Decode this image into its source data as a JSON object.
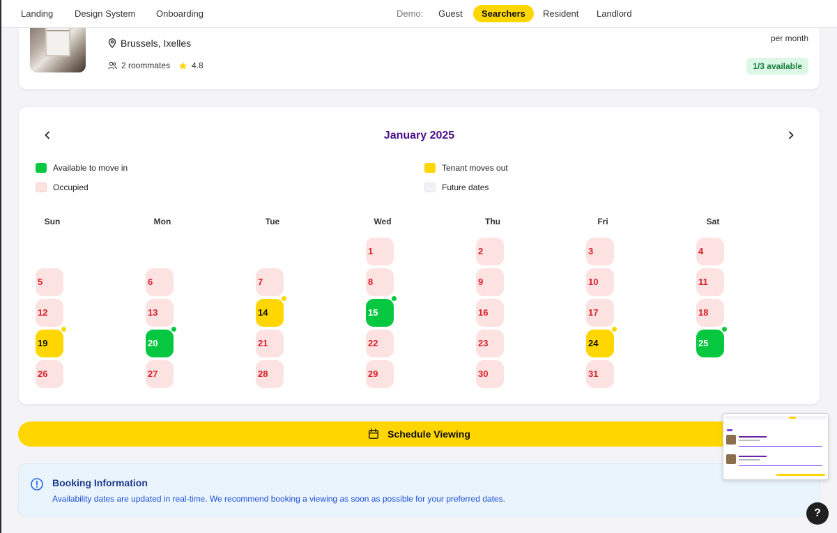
{
  "nav": {
    "links": [
      "Landing",
      "Design System",
      "Onboarding"
    ],
    "demo_label": "Demo:",
    "demo_options": [
      "Guest",
      "Searchers",
      "Resident",
      "Landlord"
    ],
    "active_demo": "Searchers"
  },
  "listing": {
    "location": "Brussels, Ixelles",
    "roommates": "2 roommates",
    "rating": "4.8",
    "price_unit": "per month",
    "availability_badge": "1/3 available"
  },
  "calendar": {
    "month_title": "January 2025",
    "legend": {
      "available": "Available to move in",
      "moveout": "Tenant moves out",
      "occupied": "Occupied",
      "future": "Future dates"
    },
    "weekdays": [
      "Sun",
      "Mon",
      "Tue",
      "Wed",
      "Thu",
      "Fri",
      "Sat"
    ],
    "first_weekday_index": 3,
    "days": [
      {
        "d": "1",
        "s": "occupied"
      },
      {
        "d": "2",
        "s": "occupied"
      },
      {
        "d": "3",
        "s": "occupied"
      },
      {
        "d": "4",
        "s": "occupied"
      },
      {
        "d": "5",
        "s": "occupied"
      },
      {
        "d": "6",
        "s": "occupied"
      },
      {
        "d": "7",
        "s": "occupied"
      },
      {
        "d": "8",
        "s": "occupied"
      },
      {
        "d": "9",
        "s": "occupied"
      },
      {
        "d": "10",
        "s": "occupied"
      },
      {
        "d": "11",
        "s": "occupied"
      },
      {
        "d": "12",
        "s": "occupied"
      },
      {
        "d": "13",
        "s": "occupied"
      },
      {
        "d": "14",
        "s": "moveout"
      },
      {
        "d": "15",
        "s": "available"
      },
      {
        "d": "16",
        "s": "occupied"
      },
      {
        "d": "17",
        "s": "occupied"
      },
      {
        "d": "18",
        "s": "occupied"
      },
      {
        "d": "19",
        "s": "moveout"
      },
      {
        "d": "20",
        "s": "available"
      },
      {
        "d": "21",
        "s": "occupied"
      },
      {
        "d": "22",
        "s": "occupied"
      },
      {
        "d": "23",
        "s": "occupied"
      },
      {
        "d": "24",
        "s": "moveout"
      },
      {
        "d": "25",
        "s": "available"
      },
      {
        "d": "26",
        "s": "occupied"
      },
      {
        "d": "27",
        "s": "occupied"
      },
      {
        "d": "28",
        "s": "occupied"
      },
      {
        "d": "29",
        "s": "occupied"
      },
      {
        "d": "30",
        "s": "occupied"
      },
      {
        "d": "31",
        "s": "occupied"
      }
    ]
  },
  "actions": {
    "schedule_label": "Schedule Viewing"
  },
  "info": {
    "title": "Booking Information",
    "text": "Availability dates are updated in real-time. We recommend booking a viewing as soon as possible for your preferred dates."
  },
  "help": {
    "label": "?"
  },
  "colors": {
    "brand_yellow": "#ffd600",
    "available_green": "#06c840",
    "occupied_bg": "#fde2e2",
    "occupied_text": "#d8202a",
    "future_bg": "#f1f2f6",
    "title_purple": "#4b0f8a"
  }
}
